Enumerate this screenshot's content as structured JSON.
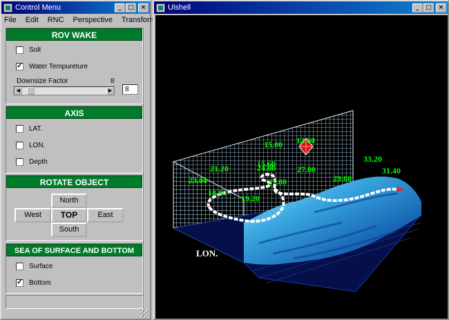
{
  "control_window": {
    "title": "Control Menu",
    "menu": [
      "File",
      "Edit",
      "RNC",
      "Perspective",
      "Transform"
    ],
    "rov_wake": {
      "title": "ROV WAKE",
      "salt_label": "Solt",
      "salt_checked": false,
      "water_label": "Water Tempureture",
      "water_checked": true,
      "downsize_label": "Downsize Factor",
      "downsize_value": "8"
    },
    "axis": {
      "title": "AXIS",
      "lat_label": "LAT.",
      "lon_label": "LON.",
      "depth_label": "Depth"
    },
    "rotate": {
      "title": "ROTATE OBJECT",
      "north": "North",
      "west": "West",
      "top": "TOP",
      "east": "East",
      "south": "South"
    },
    "sea": {
      "title": "SEA OF SURFACE AND BOTTOM",
      "surface_label": "Surface",
      "surface_checked": false,
      "bottom_label": "Bottom",
      "bottom_checked": true
    }
  },
  "viewer_window": {
    "title": "Ulshell",
    "axis_label": "LON.",
    "temp_labels": [
      "33.20",
      "31.40",
      "29.60",
      "27.80",
      "27.80",
      "12.60",
      "15.00",
      "15.60",
      "23.00",
      "19.20",
      "21.20",
      "24.00",
      "18.80"
    ]
  },
  "check_mark": "✓",
  "colors": {
    "panel_green": "#007b2a",
    "label_green": "#00ff00",
    "title_blue": "#00007b"
  }
}
